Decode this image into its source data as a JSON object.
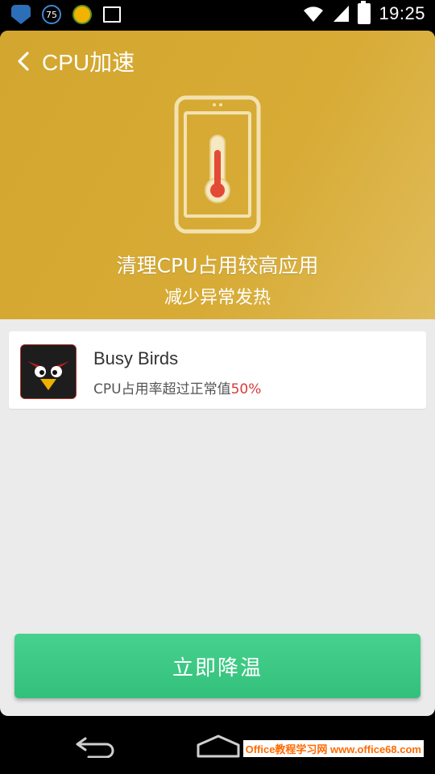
{
  "status_bar": {
    "notification_badge": "75",
    "time": "19:25"
  },
  "header": {
    "title": "CPU加速",
    "headline": "清理CPU占用较高应用",
    "subline": "减少异常发热"
  },
  "apps": [
    {
      "name": "Busy Birds",
      "desc_prefix": "CPU占用率超过正常值",
      "percent": "50%"
    }
  ],
  "action": {
    "label": "立即降温"
  },
  "watermark": {
    "text": "Office教程学习网 www.office68.com"
  },
  "colors": {
    "header_gold": "#d3a62f",
    "button_green": "#3ec985",
    "percent_red": "#d83a3a"
  }
}
